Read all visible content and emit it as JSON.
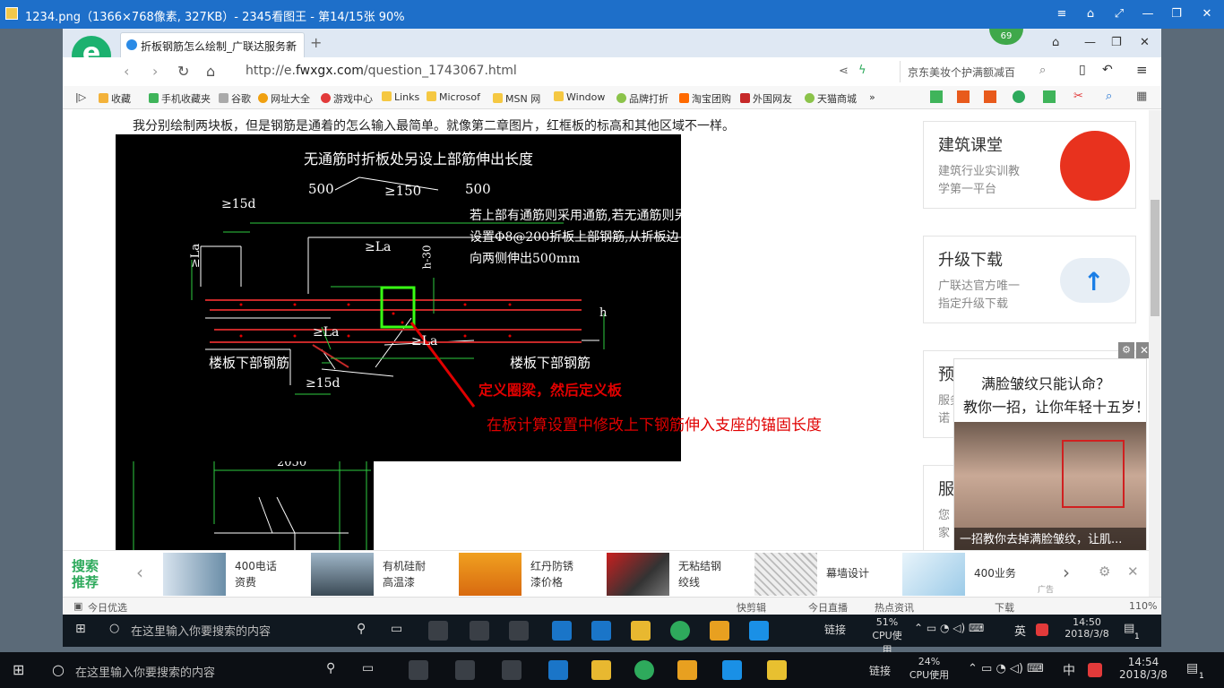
{
  "viewer": {
    "title": "1234.png（1366×768像素, 327KB）- 2345看图王 - 第14/15张 90%",
    "controls": [
      "≡",
      "⌂",
      "⤢",
      "—",
      "❐",
      "✕"
    ]
  },
  "browser": {
    "badge": "69",
    "tab_label": "折板钢筋怎么绘制_广联达服务新",
    "tab_close": "×",
    "new_tab": "+",
    "url_prefix": "http://e.",
    "url_domain": "fwxgx.com",
    "url_path": "/question_1743067.html",
    "search_text": "京东美妆个护满额减百",
    "bookmarks": [
      "收藏",
      "手机收藏夹",
      "谷歌",
      "网址大全",
      "游戏中心",
      "Links",
      "Microsof",
      "MSN 网",
      "Window",
      "品牌打折",
      "淘宝团购",
      "外国网友",
      "天猫商城",
      "»"
    ]
  },
  "page": {
    "question": "我分别绘制两块板，但是钢筋是通着的怎么输入最简单。就像第二章图片，红框板的标高和其他区域不一样。",
    "cad": {
      "title": "无通筋时折板处另设上部筋伸出长度",
      "dim_500_left": "500",
      "dim_150": "≥150",
      "dim_500_right": "500",
      "dim_15d_top": "≥15d",
      "note_line1": "若上部有通筋则采用通筋,若无通筋则另",
      "note_line2": "设置Φ8@200折板上部钢筋,从折板边",
      "note_line3": "向两侧伸出500mm",
      "la_top": "≥La",
      "la_left": "≥La",
      "la_mid": "≥La",
      "la_bottom": "≥La",
      "h_label": "h",
      "vertical_label": "h-30",
      "bottom_left": "楼板下部钢筋",
      "bottom_right": "楼板下部钢筋",
      "dim_15d_bottom": "≥15d",
      "annotation1": "定义圈梁，然后定义板",
      "annotation2": "在板计算设置中修改上下钢筋伸入支座的锚固长度",
      "cad2_dim": "2050",
      "cad2_dim2": "50"
    }
  },
  "sidebar": [
    {
      "title": "建筑课堂",
      "desc1": "建筑行业实训教",
      "desc2": "学第一平台"
    },
    {
      "title": "升级下载",
      "desc1": "广联达官方唯一",
      "desc2": "指定升级下载"
    },
    {
      "title": "预",
      "desc1": "服务",
      "desc2": "诺"
    },
    {
      "title": "服",
      "desc1": "您",
      "desc2": "家"
    }
  ],
  "ad": {
    "line1": "满脸皱纹只能认命？",
    "line2": "教你一招，让你年轻十五岁！",
    "caption": "一招教你去掉满脸皱纹，让肌...",
    "close": "✕",
    "settings": "⚙",
    "tag": "广告"
  },
  "recommend": {
    "title": "搜索推荐",
    "prev": "‹",
    "next": "›",
    "items": [
      {
        "l1": "400电话",
        "l2": "资费"
      },
      {
        "l1": "有机硅耐",
        "l2": "高温漆"
      },
      {
        "l1": "红丹防锈",
        "l2": "漆价格"
      },
      {
        "l1": "无粘结钢",
        "l2": "绞线"
      },
      {
        "l1": "幕墙设计",
        "l2": ""
      },
      {
        "l1": "400业务",
        "l2": ""
      }
    ],
    "tag": "广告"
  },
  "statusbar": {
    "left": "今日优选",
    "items": [
      "快剪辑",
      "今日直播",
      "热点资讯",
      "下载",
      "110%"
    ]
  },
  "inner_taskbar": {
    "search_placeholder": "在这里输入你要搜索的内容",
    "link": "链接",
    "cpu_pct": "51%",
    "cpu_label": "CPU使用",
    "ime": "英",
    "time": "14:50",
    "date": "2018/3/8",
    "notif": "1"
  },
  "outer_taskbar": {
    "search_placeholder": "在这里输入你要搜索的内容",
    "link": "链接",
    "cpu_pct": "24%",
    "cpu_label": "CPU使用",
    "ime": "中",
    "time": "14:54",
    "date": "2018/3/8",
    "notif": "1"
  }
}
